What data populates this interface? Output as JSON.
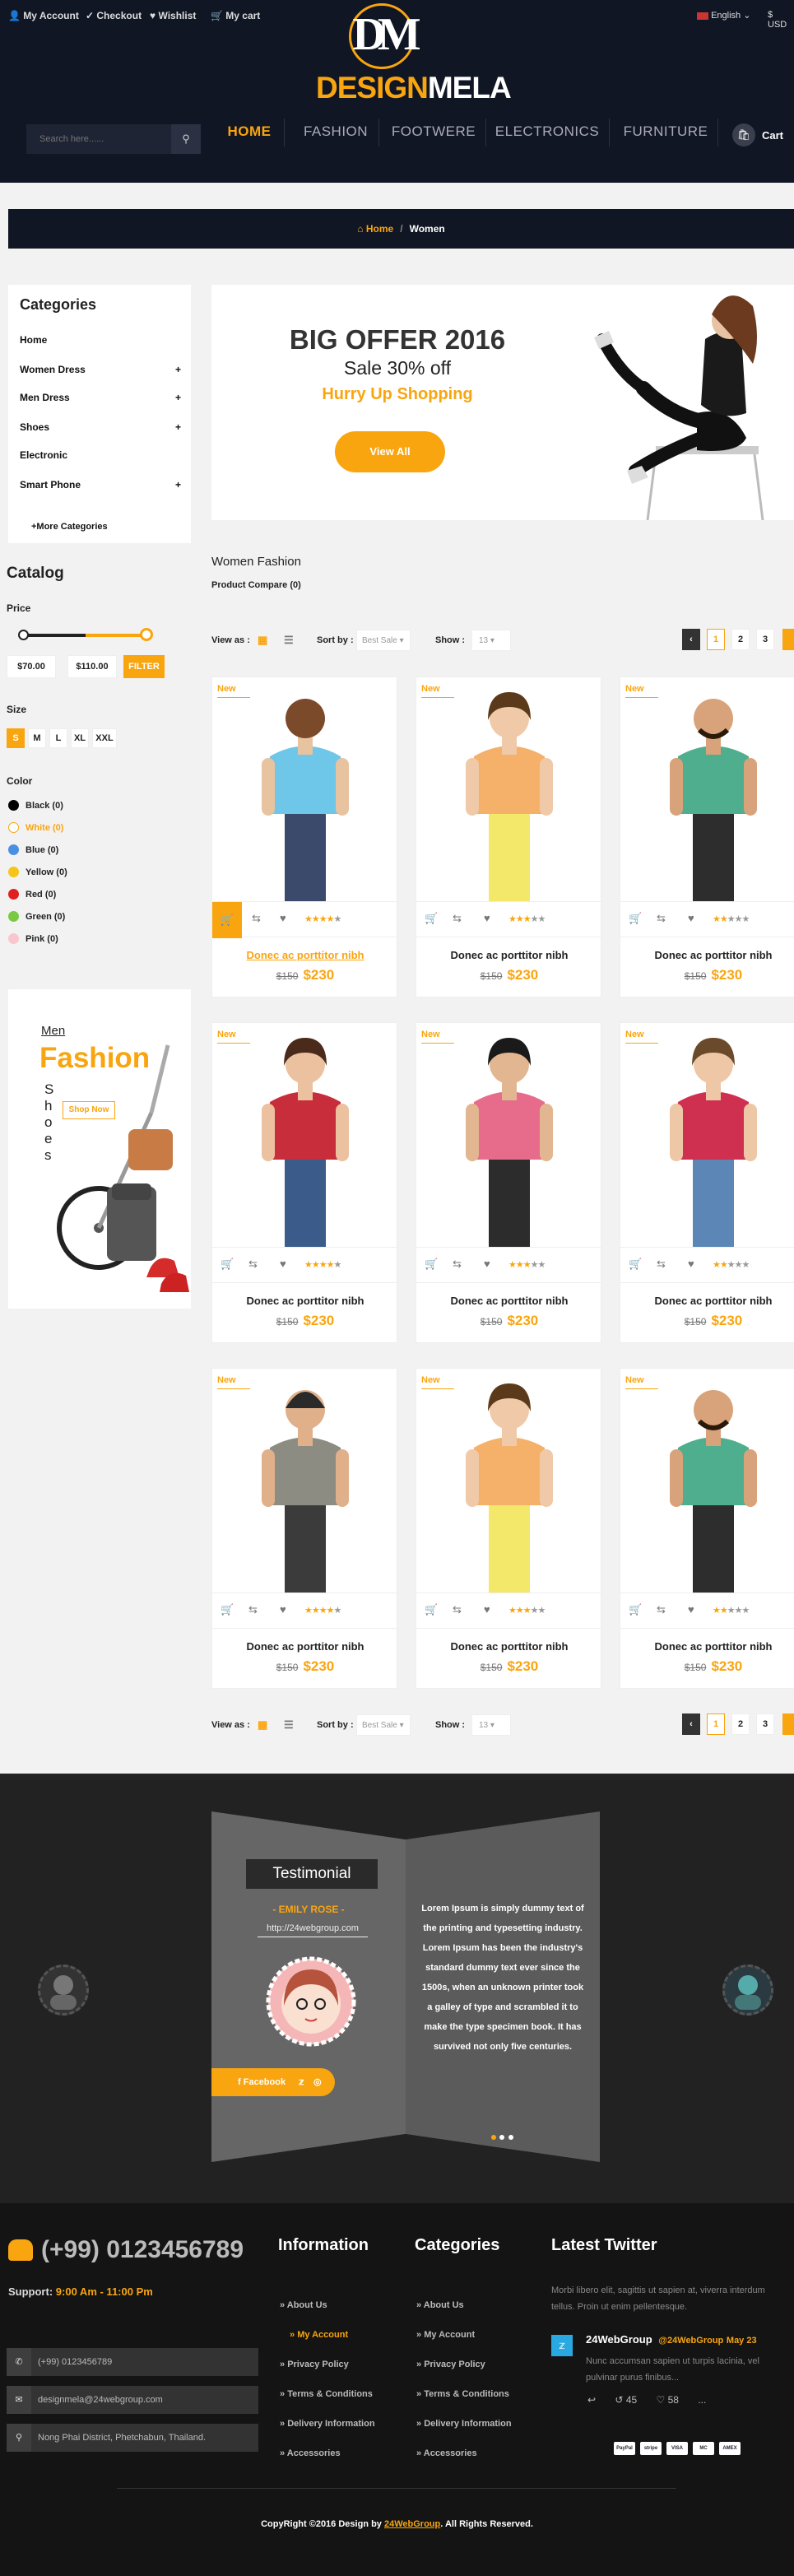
{
  "topbar": {
    "my_account": "My Account",
    "checkout": "Checkout",
    "wishlist": "Wishlist",
    "my_cart": "My cart",
    "language": "English",
    "currency": "USD"
  },
  "logo": {
    "mark": "DM",
    "word1": "DESIGN",
    "word2": "MELA"
  },
  "search": {
    "placeholder": "Search here......"
  },
  "nav": {
    "items": [
      "HOME",
      "FASHION",
      "FOOTWERE",
      "ELECTRONICS",
      "FURNITURE"
    ],
    "cart_label": "Cart"
  },
  "breadcrumb": {
    "home": "Home",
    "sep": "/",
    "current": "Women"
  },
  "categories": {
    "title": "Categories",
    "items": [
      {
        "label": "Home",
        "plus": ""
      },
      {
        "label": "Women Dress",
        "plus": "+"
      },
      {
        "label": "Men Dress",
        "plus": "+"
      },
      {
        "label": "Shoes",
        "plus": "+"
      },
      {
        "label": "Electronic",
        "plus": ""
      },
      {
        "label": "Smart Phone",
        "plus": "+"
      }
    ],
    "more": "+More Categories"
  },
  "catalog": {
    "title": "Catalog",
    "price_label": "Price",
    "price_min": "$70.00",
    "price_max": "$110.00",
    "filter_button": "FILTER",
    "size_label": "Size",
    "sizes": [
      "S",
      "M",
      "L",
      "XL",
      "XXL"
    ],
    "color_label": "Color",
    "colors": [
      {
        "label": "Black (0)",
        "hex": "#000000"
      },
      {
        "label": "White (0)",
        "hex": "#ffffff"
      },
      {
        "label": "Blue (0)",
        "hex": "#4a90e2"
      },
      {
        "label": "Yellow (0)",
        "hex": "#f5c518"
      },
      {
        "label": "Red (0)",
        "hex": "#e02020"
      },
      {
        "label": "Green (0)",
        "hex": "#7ac943"
      },
      {
        "label": "Pink (0)",
        "hex": "#f7c6cf"
      }
    ]
  },
  "side_banner": {
    "small": "Men",
    "big": "Fashion",
    "vertical": "Shoes",
    "button": "Shop Now"
  },
  "hero": {
    "title": "BIG OFFER 2016",
    "subtitle": "Sale 30% off",
    "tagline": "Hurry Up Shopping",
    "button": "View All"
  },
  "listing": {
    "heading": "Women Fashion",
    "compare": "Product Compare (0)",
    "view_as": "View as :",
    "sort_by": "Sort by :",
    "sort_value": "Best Sale",
    "show": "Show :",
    "show_value": "13",
    "pages": [
      "1",
      "2",
      "3"
    ]
  },
  "products": [
    {
      "badge": "New",
      "name": "Donec ac porttitor nibh",
      "old_price": "$150",
      "price": "$230",
      "rating": 4,
      "highlight": true
    },
    {
      "badge": "New",
      "name": "Donec ac porttitor nibh",
      "old_price": "$150",
      "price": "$230",
      "rating": 3,
      "highlight": false
    },
    {
      "badge": "New",
      "name": "Donec ac porttitor nibh",
      "old_price": "$150",
      "price": "$230",
      "rating": 2,
      "highlight": false
    },
    {
      "badge": "New",
      "name": "Donec ac porttitor nibh",
      "old_price": "$150",
      "price": "$230",
      "rating": 4,
      "highlight": false
    },
    {
      "badge": "New",
      "name": "Donec ac porttitor nibh",
      "old_price": "$150",
      "price": "$230",
      "rating": 3,
      "highlight": false
    },
    {
      "badge": "New",
      "name": "Donec ac porttitor nibh",
      "old_price": "$150",
      "price": "$230",
      "rating": 2,
      "highlight": false
    },
    {
      "badge": "New",
      "name": "Donec ac porttitor nibh",
      "old_price": "$150",
      "price": "$230",
      "rating": 4,
      "highlight": false
    },
    {
      "badge": "New",
      "name": "Donec ac porttitor nibh",
      "old_price": "$150",
      "price": "$230",
      "rating": 3,
      "highlight": false
    },
    {
      "badge": "New",
      "name": "Donec ac porttitor nibh",
      "old_price": "$150",
      "price": "$230",
      "rating": 2,
      "highlight": false
    }
  ],
  "testimonial": {
    "title": "Testimonial",
    "name": "- EMILY ROSE -",
    "url": "http://24webgroup.com",
    "facebook": "Facebook",
    "text": "Lorem Ipsum is simply dummy text of the printing and typesetting industry. Lorem Ipsum has been the industry's standard dummy text ever since the 1500s, when an unknown printer took a galley of type and scrambled it to make the type specimen book. It has survived not only five centuries."
  },
  "footer": {
    "phone_big": "(+99) 0123456789",
    "support_label": "Support:",
    "support_hours": "9:00 Am - 11:00 Pm",
    "contact_phone": "(+99) 0123456789",
    "contact_email": "designmela@24webgroup.com",
    "contact_address": "Nong Phai District, Phetchabun, Thailand.",
    "info_title": "Information",
    "info_links": [
      "About Us",
      "My Account",
      "Privacy Policy",
      "Terms & Conditions",
      "Delivery Information",
      "Accessories"
    ],
    "cat_title": "Categories",
    "cat_links": [
      "About Us",
      "My Account",
      "Privacy Policy",
      "Terms & Conditions",
      "Delivery Information",
      "Accessories"
    ],
    "twitter_title": "Latest Twitter",
    "twitter_intro": "Morbi libero elit, sagittis ut sapien at, viverra interdum tellus. Proin ut enim pellentesque.",
    "tweet_user": "24WebGroup",
    "tweet_handle": "@24WebGroup",
    "tweet_date": "May 23",
    "tweet_text": "Nunc accumsan sapien ut turpis lacinia, vel pulvinar purus finibus...",
    "tweet_retweets": "45",
    "tweet_likes": "58",
    "tweet_more": "...",
    "payments": [
      "PayPal",
      "stripe",
      "VISA",
      "MC",
      "AMEX"
    ],
    "copyright_pre": "CopyRight ©2016  Design by ",
    "copyright_brand": "24WebGroup",
    "copyright_post": ". All Rights Reserved."
  }
}
